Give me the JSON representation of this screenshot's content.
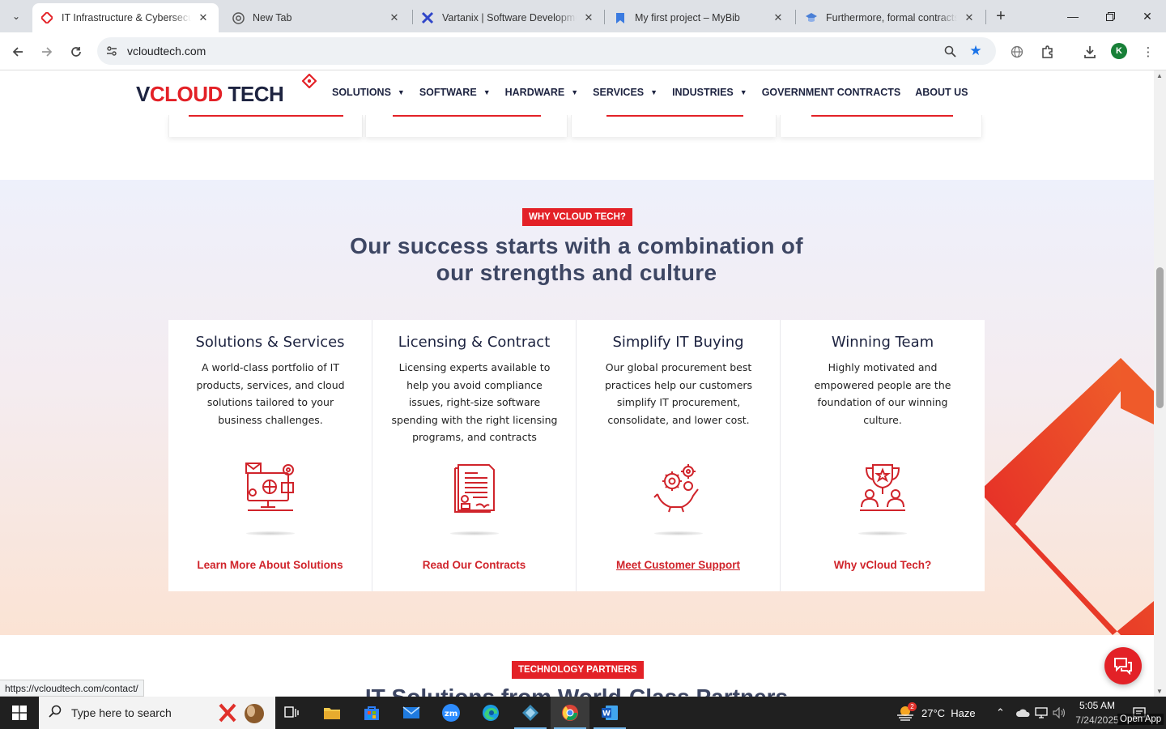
{
  "browser": {
    "tabs": [
      {
        "title": "IT Infrastructure & Cybersecurity",
        "active": true
      },
      {
        "title": "New Tab",
        "active": false
      },
      {
        "title": "Vartanix | Software Development",
        "active": false
      },
      {
        "title": "My first project – MyBib",
        "active": false
      },
      {
        "title": "Furthermore, formal contracts c",
        "active": false
      }
    ],
    "url": "vcloudtech.com",
    "profile_initial": "K",
    "status_url": "https://vcloudtech.com/contact/"
  },
  "site": {
    "logo": {
      "v": "V",
      "cloud": "CLOUD",
      "tech": " TECH"
    },
    "menu": [
      {
        "label": "SOLUTIONS",
        "has_caret": true
      },
      {
        "label": "SOFTWARE",
        "has_caret": true
      },
      {
        "label": "HARDWARE",
        "has_caret": true
      },
      {
        "label": "SERVICES",
        "has_caret": true
      },
      {
        "label": "INDUSTRIES",
        "has_caret": true
      },
      {
        "label": "GOVERNMENT CONTRACTS",
        "has_caret": false
      },
      {
        "label": "ABOUT US",
        "has_caret": false
      }
    ],
    "why": {
      "badge": "WHY VCLOUD TECH?",
      "title_line1": "Our success starts with a combination of",
      "title_line2": "our strengths and culture",
      "cards": [
        {
          "title": "Solutions & Services",
          "text": "A world-class portfolio of IT products, services, and cloud solutions tailored to your business challenges.",
          "icon": "computer-network-icon",
          "link": "Learn More About Solutions"
        },
        {
          "title": "Licensing & Contract",
          "text": "Licensing experts available to help you avoid compliance issues, right-size software spending with the right licensing programs, and contracts",
          "icon": "contract-document-icon",
          "link": "Read Our Contracts"
        },
        {
          "title": "Simplify IT Buying",
          "text": "Our global procurement best practices help our customers simplify IT procurement, consolidate, and lower cost.",
          "icon": "gears-hand-icon",
          "link": "Meet Customer Support"
        },
        {
          "title": "Winning Team",
          "text": "Highly motivated and empowered people are the foundation of our winning culture.",
          "icon": "trophy-team-icon",
          "link": "Why vCloud Tech?"
        }
      ]
    },
    "partners": {
      "badge": "TECHNOLOGY PARTNERS",
      "title": "IT Solutions from World-Class Partners"
    },
    "accent_color": "#e32127"
  },
  "taskbar": {
    "search_placeholder": "Type here to search",
    "weather": "27°C  Haze",
    "weather_badge": "2",
    "time": "5:05 AM",
    "date": "7/24/2025",
    "overlay": "Open App"
  }
}
